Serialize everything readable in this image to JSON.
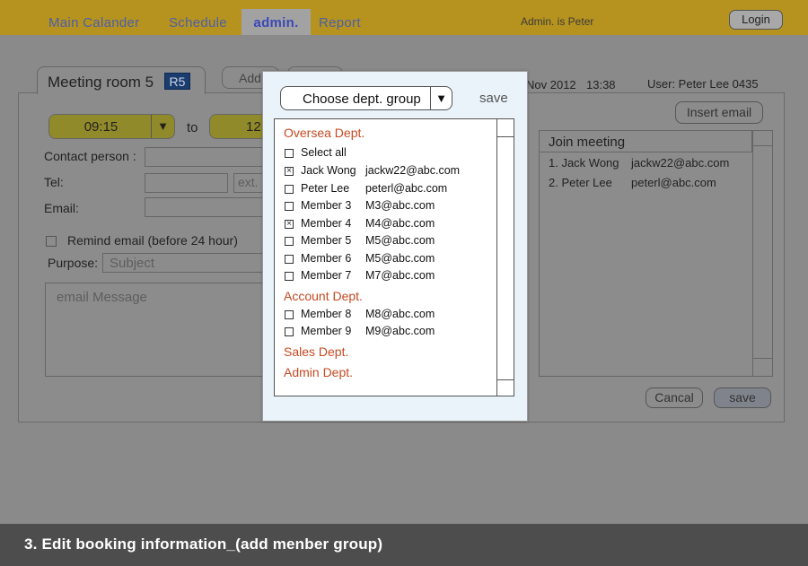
{
  "nav": {
    "items": [
      {
        "label": "Main Calander"
      },
      {
        "label": "Schedule"
      },
      {
        "label": "admin."
      },
      {
        "label": "Report"
      }
    ],
    "user_text": "Admin. is Peter",
    "login_label": "Login"
  },
  "booking": {
    "room_label": "Meeting room 5",
    "room_badge": "R5",
    "add_tab_label": "Add",
    "date_text": "Nov 2012",
    "time_text": "13:38",
    "user_text": "User:  Peter Lee  0435",
    "start_time": "09:15",
    "end_time": "12",
    "to_label": "to",
    "contact_label": "Contact person :",
    "tel_label": "Tel:",
    "ext_placeholder": "ext.",
    "email_label": "Email:",
    "remind_label": "Remind email (before 24 hour)",
    "purpose_label": "Purpose:",
    "subject_placeholder": "Subject",
    "message_placeholder": "email Message",
    "insert_email_label": "Insert email",
    "join_header": "Join meeting",
    "join_list": [
      {
        "name": "1. Jack Wong",
        "email": "jackw22@abc.com"
      },
      {
        "name": "2. Peter Lee",
        "email": "peterl@abc.com"
      }
    ],
    "cancel_label": "Cancal",
    "save_label": "save"
  },
  "popup": {
    "select_label": "Choose dept. group",
    "save_label": "save",
    "oversea_dept": "Oversea Dept.",
    "select_all": "Select all",
    "oversea_members": [
      {
        "name": "Jack Wong",
        "email": "jackw22@abc.com",
        "checked": true
      },
      {
        "name": "Peter Lee",
        "email": "peterl@abc.com",
        "checked": false
      },
      {
        "name": "Member 3",
        "email": "M3@abc.com",
        "checked": false
      },
      {
        "name": "Member 4",
        "email": "M4@abc.com",
        "checked": true
      },
      {
        "name": "Member 5",
        "email": "M5@abc.com",
        "checked": false
      },
      {
        "name": "Member 6",
        "email": "M5@abc.com",
        "checked": false
      },
      {
        "name": "Member 7",
        "email": "M7@abc.com",
        "checked": false
      }
    ],
    "account_dept": "Account Dept.",
    "account_members": [
      {
        "name": "Member 8",
        "email": "M8@abc.com",
        "checked": false
      },
      {
        "name": "Member 9",
        "email": "M9@abc.com",
        "checked": false
      }
    ],
    "sales_dept": "Sales Dept.",
    "admin_dept": "Admin Dept."
  },
  "caption": "3. Edit booking information_(add menber group)",
  "colors": {
    "topbar": "#b6931e",
    "overlay": "#8c8c8c",
    "popup_bg": "#e9f3f9",
    "dept_heading": "#c44a22",
    "nav_link": "#4b5faa",
    "room_badge": "#1b3d6d"
  }
}
